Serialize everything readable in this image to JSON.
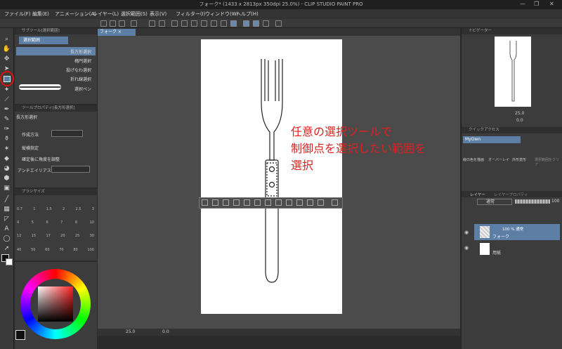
{
  "window": {
    "title": "フォーク* (1433 x 2813px 350dpi 25.0%) - CLIP STUDIO PAINT PRO",
    "min": "—",
    "max": "❐",
    "close": "✕"
  },
  "menu": [
    "ファイル(F)",
    "編集(E)",
    "アニメーション(A)",
    "レイヤー(L)",
    "選択範囲(S)",
    "表示(V)",
    "フィルター(I)",
    "ウィンドウ(W)",
    "ヘルプ(H)"
  ],
  "subtool_panel": {
    "header": "サブツール[選択範囲]",
    "group": "選択範囲",
    "items": [
      "長方形選択",
      "楕円選択",
      "投げなわ選択",
      "折れ線選択",
      "選択ペン"
    ]
  },
  "tool_property": {
    "header": "ツールプロパティ[長方形選択]",
    "name": "長方形選択",
    "labels": [
      "作成方法",
      "縦横指定",
      "確定後に角度を調整",
      "アンチエイリアス"
    ]
  },
  "brush_size": {
    "header": "ブラシサイズ",
    "row1": [
      "0.7",
      "1",
      "1.5",
      "2",
      "2.5",
      "3"
    ],
    "row2": [
      "4",
      "5",
      "6",
      "7",
      "8",
      "10"
    ],
    "row3": [
      "12",
      "15",
      "17",
      "20",
      "25",
      "30"
    ],
    "row4": [
      "40",
      "50",
      "60",
      "70",
      "80",
      "100"
    ]
  },
  "document_tab": "フォーク ×",
  "annotation": {
    "line1": "任意の選択ツールで",
    "line2": "制御点を選択したい範囲を",
    "line3": "選択"
  },
  "status": {
    "zoom": "25.0",
    "angle": "0.0"
  },
  "navigator": {
    "header": "ナビゲーター",
    "zoom": "25.0",
    "angle": "0.0"
  },
  "quick_access": {
    "header": "クイックアクセス",
    "set": "MyOwn",
    "items": [
      "線の色を描画",
      "オーバーレイ",
      "外形変形",
      "選択範囲をクリア"
    ]
  },
  "layer_panel": {
    "tabs": [
      "レイヤー",
      "レイヤープロパティ"
    ],
    "blend_mode": "通常",
    "opacity": "100",
    "layers": [
      {
        "top": "100 % 通常",
        "name": "フォーク"
      },
      {
        "top": "",
        "name": "用紙"
      }
    ]
  },
  "colors": {
    "accent": "#5d7fa6",
    "annotation": "#e02020",
    "highlight": "#e01010"
  }
}
